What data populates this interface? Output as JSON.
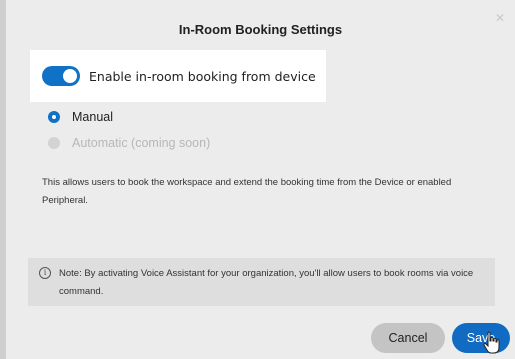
{
  "dialog": {
    "title": "In-Room Booking Settings",
    "close_icon": "close-icon"
  },
  "toggle": {
    "label": "Enable in-room booking from device",
    "state": "on",
    "accent": "#0f72c7"
  },
  "mode": {
    "options": [
      {
        "label": "Manual",
        "selected": true,
        "enabled": true
      },
      {
        "label": "Automatic (coming soon)",
        "selected": false,
        "enabled": false
      }
    ]
  },
  "description": "This allows users to book the workspace and extend the booking time from the Device or enabled Peripheral.",
  "note": {
    "icon": "info-icon",
    "text": "Note: By activating Voice Assistant for your organization, you'll allow users to book rooms via voice command."
  },
  "actions": {
    "cancel_label": "Cancel",
    "save_label": "Save"
  }
}
